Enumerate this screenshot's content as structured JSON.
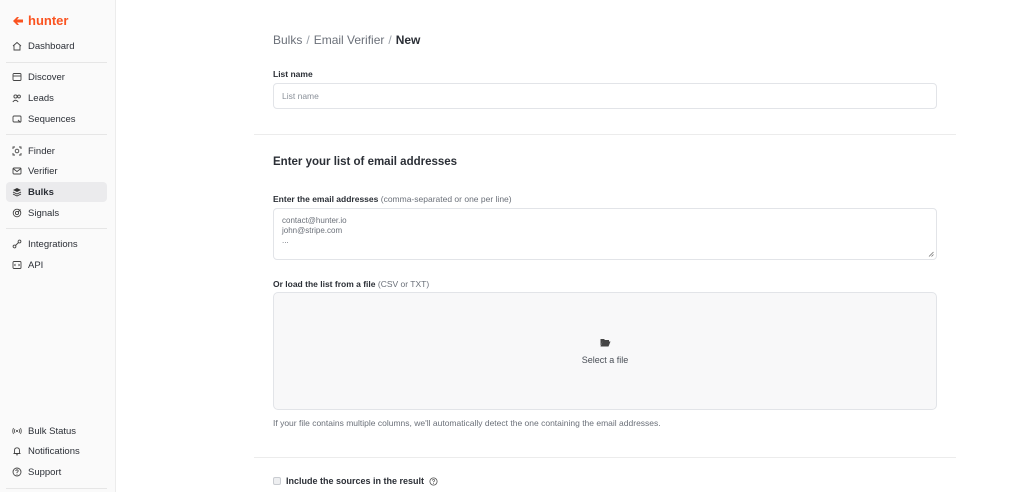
{
  "app": {
    "brand": "hunter",
    "brand_color": "#fa5320"
  },
  "sidebar": {
    "items": [
      {
        "label": "Dashboard",
        "icon": "home-icon"
      },
      {
        "label": "Discover",
        "icon": "discover-icon"
      },
      {
        "label": "Leads",
        "icon": "leads-icon"
      },
      {
        "label": "Sequences",
        "icon": "sequences-icon"
      },
      {
        "label": "Finder",
        "icon": "finder-icon"
      },
      {
        "label": "Verifier",
        "icon": "verifier-icon"
      },
      {
        "label": "Bulks",
        "icon": "bulks-icon"
      },
      {
        "label": "Signals",
        "icon": "signals-icon"
      },
      {
        "label": "Integrations",
        "icon": "integrations-icon"
      },
      {
        "label": "API",
        "icon": "api-icon"
      }
    ],
    "bottom": [
      {
        "label": "Bulk Status",
        "icon": "broadcast-icon"
      },
      {
        "label": "Notifications",
        "icon": "bell-icon"
      },
      {
        "label": "Support",
        "icon": "help-icon"
      }
    ],
    "active": "Bulks"
  },
  "breadcrumb": {
    "part1": "Bulks",
    "sep": "/",
    "part2": "Email Verifier",
    "current": "New"
  },
  "form": {
    "list_name_label": "List name",
    "list_name_placeholder": "List name",
    "section_title": "Enter your list of email addresses",
    "emails_label": "Enter the email addresses",
    "emails_hint": "(comma-separated or one per line)",
    "emails_placeholder_lines": [
      "contact@hunter.io",
      "john@stripe.com",
      "..."
    ],
    "file_label": "Or load the list from a file",
    "file_hint": "(CSV or TXT)",
    "select_file": "Select a file",
    "file_helper": "If your file contains multiple columns, we'll automatically detect the one containing the email addresses.",
    "include_sources": "Include the sources in the result"
  }
}
